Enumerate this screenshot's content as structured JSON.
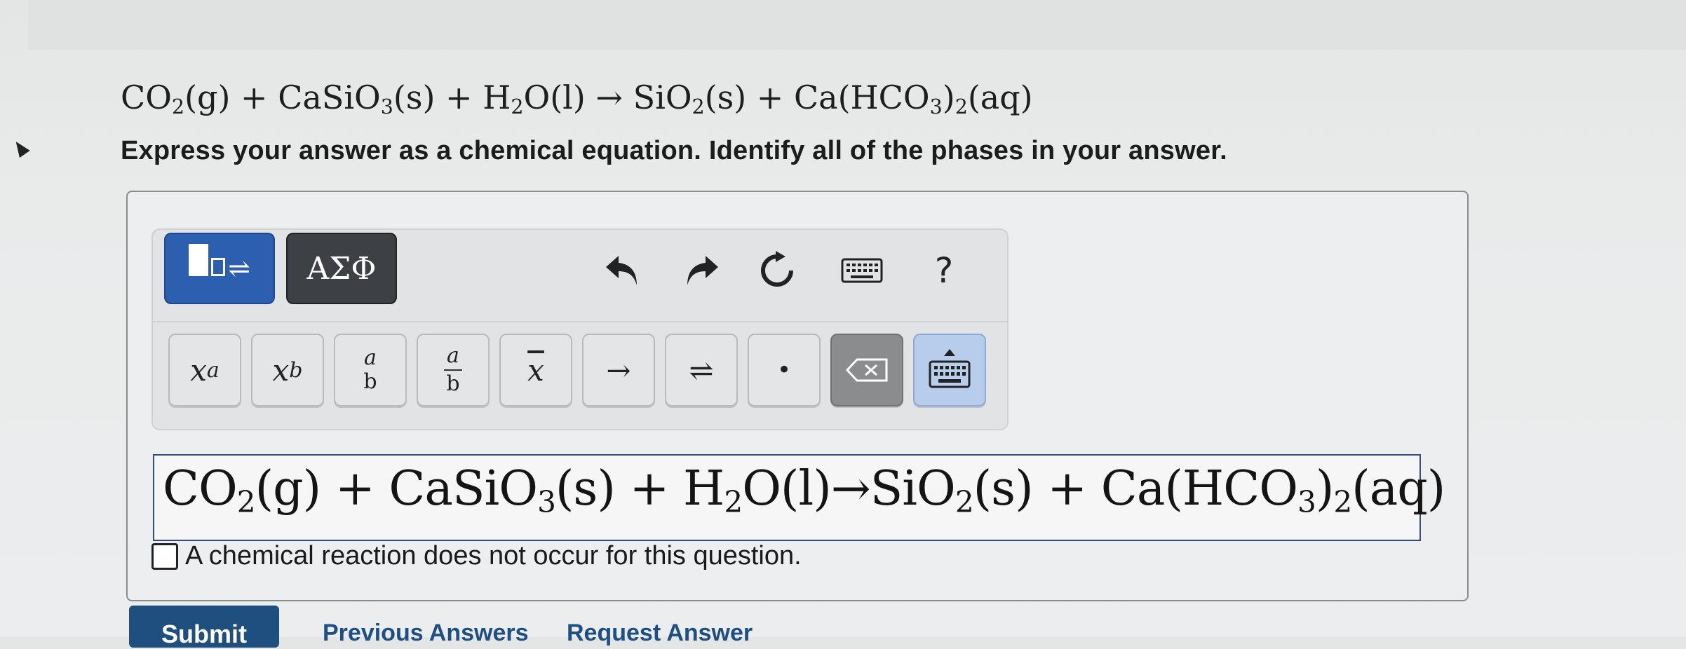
{
  "question": {
    "equation_parts": [
      "CO",
      "2",
      "(g) + CaSiO",
      "3",
      "(s) + H",
      "2",
      "O(l) → SiO",
      "2",
      "(s) + Ca(HCO",
      "3",
      ")",
      "2",
      "(aq)"
    ],
    "instructions": "Express your answer as a chemical equation. Identify all of the phases in your answer."
  },
  "toolbar": {
    "greek_label": "ΑΣΦ",
    "help_label": "?",
    "keys": {
      "superscript_base": "x",
      "superscript_exp": "a",
      "subscript_base": "x",
      "subscript_sub": "b",
      "frac_num": "a",
      "frac_den": "b",
      "mixed_num": "a",
      "mixed_den": "b",
      "bar_label": "x",
      "arrow_label": "→",
      "equilibrium_label": "⇌",
      "dot_label": "•"
    }
  },
  "answer": {
    "parts": [
      "CO",
      "2",
      "(g) + CaSiO",
      "3",
      "(s) + H",
      "2",
      "O(l)→SiO",
      "2",
      "(s) + Ca(HCO",
      "3",
      ")",
      "2",
      "(aq)"
    ]
  },
  "no_reaction_label": "A chemical reaction does not occur for this question.",
  "buttons": {
    "submit": "Submit",
    "previous_answers": "Previous Answers",
    "request_answer": "Request Answer"
  },
  "colors": {
    "template_mode": "#2d5fb0",
    "greek_mode": "#3d4045",
    "submit": "#1f4f7f",
    "keyboard_toggle": "#b8cdeb"
  },
  "icons": [
    "template-mode-icon",
    "undo-icon",
    "redo-icon",
    "reset-icon",
    "keyboard-icon",
    "help-icon",
    "backspace-icon",
    "keyboard-toggle-icon"
  ]
}
